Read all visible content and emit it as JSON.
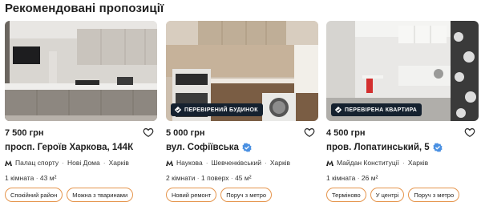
{
  "section": {
    "title": "Рекомендовані пропозиції"
  },
  "colors": {
    "tag_border": "#e5954d",
    "badge_bg": "#15212f",
    "verified": "#4a90e2"
  },
  "cards": [
    {
      "price": "7 500 грн",
      "street": "просп. Героїв Харкова, 144К",
      "verified": false,
      "badge": "",
      "metro": "Палац спорту",
      "district": "Нові Дома",
      "city": "Харків",
      "rooms": "1 кімната",
      "floor": "",
      "area": "43 м²",
      "tags": [
        "Спокійний район",
        "Можна з тваринами"
      ]
    },
    {
      "price": "5 000 грн",
      "street": "вул. Софіївська",
      "verified": true,
      "badge": "ПЕРЕВІРЕНИЙ БУДИНОК",
      "metro": "Наукова",
      "district": "Шевченківський",
      "city": "Харків",
      "rooms": "2 кімнати",
      "floor": "1 поверх",
      "area": "45 м²",
      "tags": [
        "Новий ремонт",
        "Поруч з метро"
      ]
    },
    {
      "price": "4 500 грн",
      "street": "пров. Лопатинський, 5",
      "verified": true,
      "badge": "ПЕРЕВІРЕНА КВАРТИРА",
      "metro": "Майдан Конституції",
      "district": "",
      "city": "Харків",
      "rooms": "1 кімната",
      "floor": "",
      "area": "26 м²",
      "tags": [
        "Терміново",
        "У центрі",
        "Поруч з метро"
      ]
    }
  ]
}
